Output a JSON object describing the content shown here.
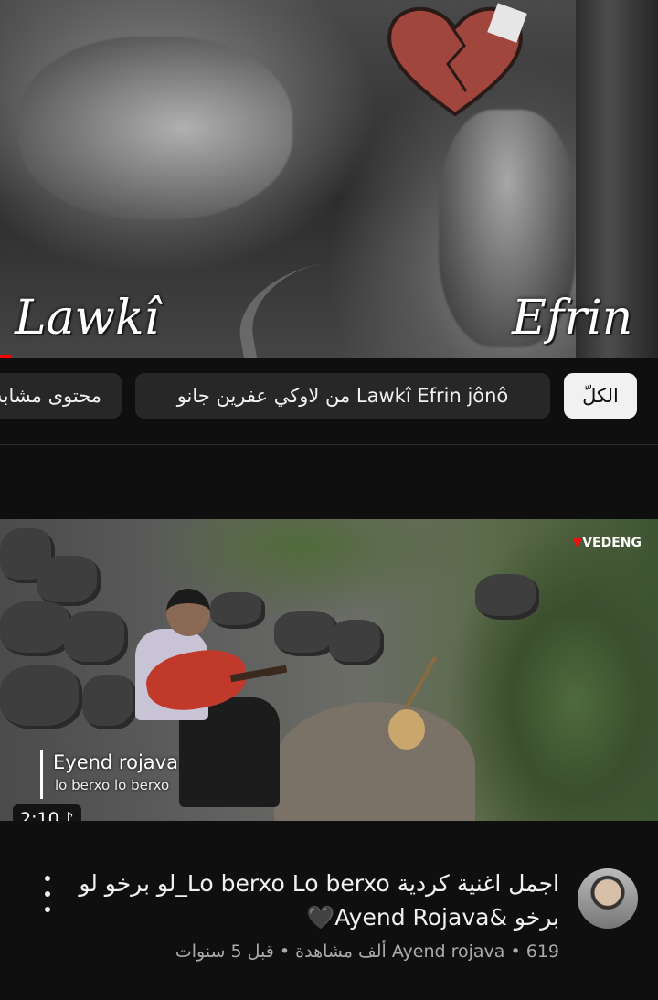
{
  "player": {
    "overlay_left": "Lawkî",
    "overlay_right": "Efrin"
  },
  "chips": [
    {
      "label": "الكلّ",
      "selected": true
    },
    {
      "label": "من لاوكي عفرين جانو Lawkî Efrin jônô",
      "selected": false
    },
    {
      "label": "محتوى مشابه",
      "selected": false
    }
  ],
  "video": {
    "thumbnail": {
      "watermark": "VEDENG",
      "caption_title": "Eyend rojava",
      "caption_subtitle": "lo berxo lo berxo",
      "duration": "2:10",
      "duration_icon": "music-note-icon"
    },
    "title": "اجمل اغنية كردية Lo berxo Lo berxo_لو برخو لو برخو &Ayend Rojava🖤",
    "channel": "Ayend rojava",
    "views": "619 ألف مشاهدة",
    "age": "قبل 5 سنوات",
    "sub_line": "Ayend rojava • 619 ألف مشاهدة • قبل 5 سنوات"
  },
  "colors": {
    "background": "#0f0f0f",
    "chip_bg": "#272727",
    "chip_selected_bg": "#f1f1f1",
    "secondary_text": "#aaaaaa"
  }
}
